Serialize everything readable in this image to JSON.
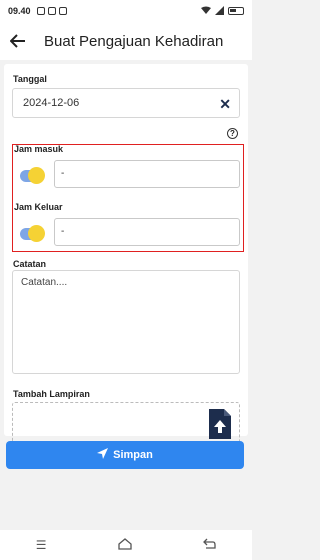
{
  "status_bar": {
    "time": "09.40"
  },
  "app_bar": {
    "back_icon": "arrow-left-icon",
    "title": "Buat Pengajuan Kehadiran"
  },
  "form": {
    "date_label": "Tanggal",
    "date_value": "2024-12-06",
    "clear_icon": "close-icon",
    "help_icon": "question-circle-icon",
    "jam_masuk_label": "Jam masuk",
    "jam_masuk_value": "-",
    "jam_keluar_label": "Jam Keluar",
    "jam_keluar_value": "-",
    "notes_label": "Catatan",
    "notes_placeholder": "Catatan....",
    "attachment_label": "Tambah Lampiran",
    "attachment_icon": "file-upload-icon"
  },
  "save_button": {
    "label": "Simpan",
    "icon": "send-icon",
    "color": "#2f86ef"
  },
  "nav_bar": {
    "items": [
      "menu-icon",
      "home-icon",
      "back-icon"
    ]
  }
}
